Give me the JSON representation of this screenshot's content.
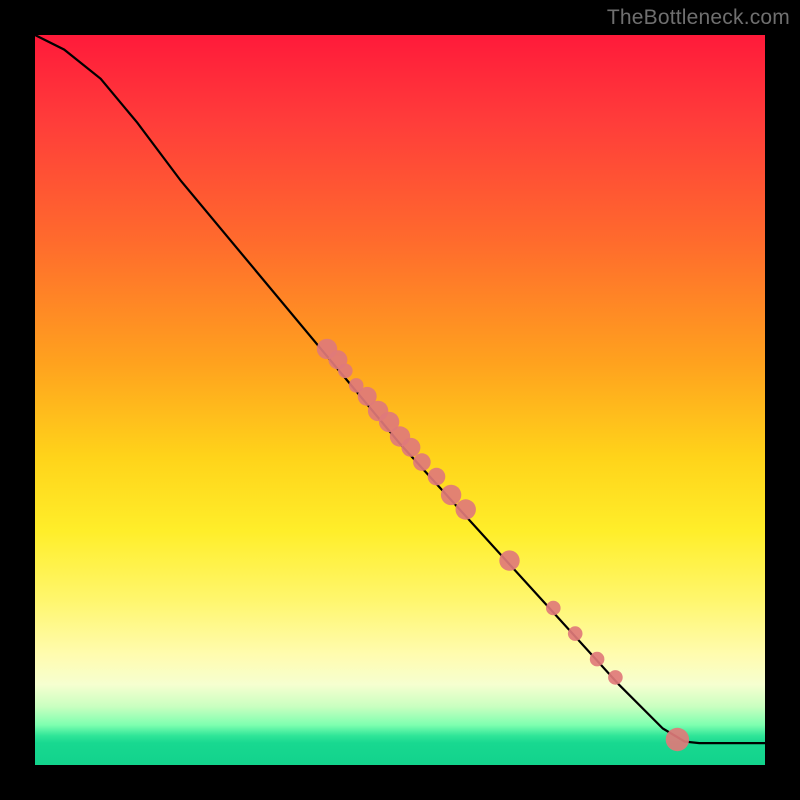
{
  "watermark": "TheBottleneck.com",
  "chart_data": {
    "type": "line",
    "title": "",
    "xlabel": "",
    "ylabel": "",
    "xlim": [
      0,
      100
    ],
    "ylim": [
      0,
      100
    ],
    "curve": [
      {
        "x": 0,
        "y": 100
      },
      {
        "x": 4,
        "y": 98
      },
      {
        "x": 9,
        "y": 94
      },
      {
        "x": 14,
        "y": 88
      },
      {
        "x": 20,
        "y": 80
      },
      {
        "x": 30,
        "y": 68
      },
      {
        "x": 40,
        "y": 56
      },
      {
        "x": 50,
        "y": 44
      },
      {
        "x": 60,
        "y": 33
      },
      {
        "x": 70,
        "y": 22
      },
      {
        "x": 80,
        "y": 11
      },
      {
        "x": 86,
        "y": 5
      },
      {
        "x": 89,
        "y": 3.2
      },
      {
        "x": 91,
        "y": 3
      },
      {
        "x": 100,
        "y": 3
      }
    ],
    "points": [
      {
        "x": 40,
        "y": 57,
        "r": 1.4
      },
      {
        "x": 41.5,
        "y": 55.5,
        "r": 1.3
      },
      {
        "x": 42.5,
        "y": 54,
        "r": 1.0
      },
      {
        "x": 44,
        "y": 52,
        "r": 1.0
      },
      {
        "x": 45.5,
        "y": 50.5,
        "r": 1.3
      },
      {
        "x": 47,
        "y": 48.5,
        "r": 1.4
      },
      {
        "x": 48.5,
        "y": 47,
        "r": 1.4
      },
      {
        "x": 50,
        "y": 45,
        "r": 1.4
      },
      {
        "x": 51.5,
        "y": 43.5,
        "r": 1.3
      },
      {
        "x": 53,
        "y": 41.5,
        "r": 1.2
      },
      {
        "x": 55,
        "y": 39.5,
        "r": 1.2
      },
      {
        "x": 57,
        "y": 37,
        "r": 1.4
      },
      {
        "x": 59,
        "y": 35,
        "r": 1.4
      },
      {
        "x": 65,
        "y": 28,
        "r": 1.4
      },
      {
        "x": 71,
        "y": 21.5,
        "r": 1.0
      },
      {
        "x": 74,
        "y": 18,
        "r": 1.0
      },
      {
        "x": 77,
        "y": 14.5,
        "r": 1.0
      },
      {
        "x": 79.5,
        "y": 12,
        "r": 1.0
      },
      {
        "x": 88,
        "y": 3.5,
        "r": 1.6
      }
    ],
    "point_color": "#e07a7a",
    "line_color": "#000000"
  }
}
